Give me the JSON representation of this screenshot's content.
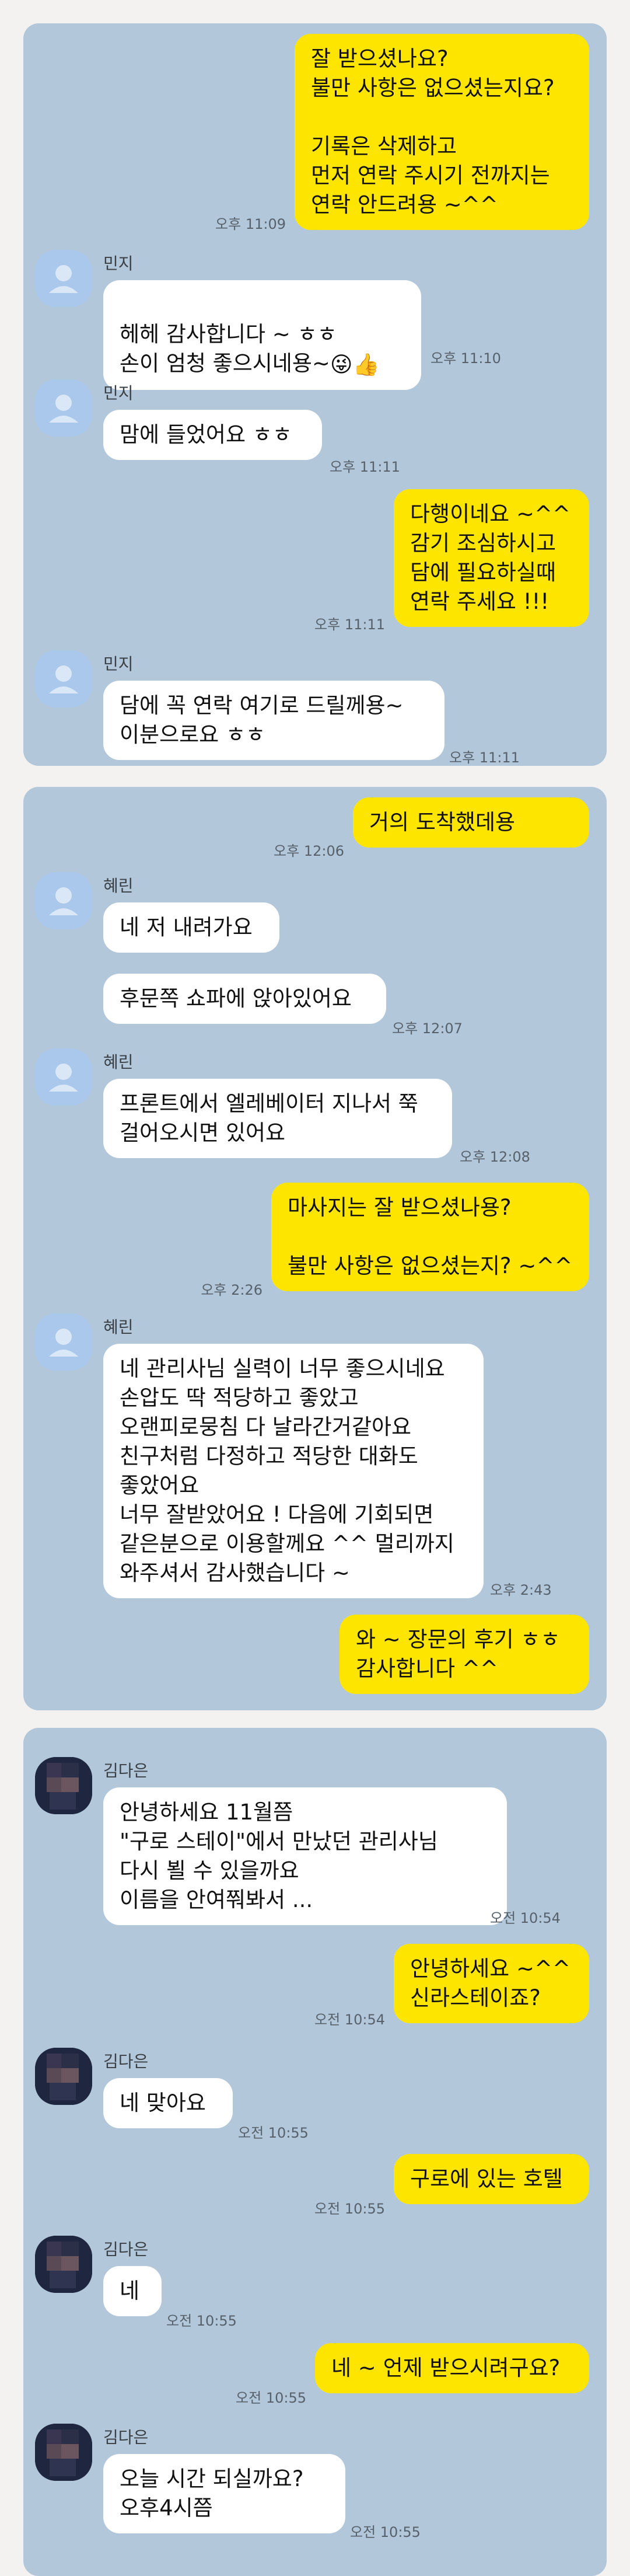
{
  "panels": [
    {
      "messages": [
        {
          "side": "me",
          "text": "잘 받으셨나요?\n불만 사항은 없으셨는지요?\n\n기록은 삭제하고\n먼저 연락 주시기 전까지는\n연락 안드려용 ~^^",
          "time": "오후 11:09"
        },
        {
          "side": "them",
          "sender": "민지",
          "text": "헤헤 감사합니다 ~ ㅎㅎ\n손이 엄청 좋으시네용~",
          "emoji": "😜👍",
          "time": "오후 11:10"
        },
        {
          "side": "them",
          "sender": "민지",
          "text": "맘에 들었어요 ㅎㅎ",
          "time": "오후 11:11"
        },
        {
          "side": "me",
          "text": "다행이네요 ~^^\n감기 조심하시고\n담에 필요하실때\n연락 주세요 !!!",
          "time": "오후 11:11"
        },
        {
          "side": "them",
          "sender": "민지",
          "text": "담에 꼭 연락 여기로 드릴께용~\n이분으로요 ㅎㅎ",
          "time": "오후 11:11"
        }
      ]
    },
    {
      "messages": [
        {
          "side": "me",
          "text": "거의 도착했데용",
          "time": "오후 12:06"
        },
        {
          "side": "them",
          "sender": "혜린",
          "text": "네 저 내려가요",
          "time": ""
        },
        {
          "side": "them",
          "text": "후문쪽 쇼파에 앉아있어요",
          "time": "오후 12:07"
        },
        {
          "side": "them",
          "sender": "혜린",
          "text": "프론트에서 엘레베이터 지나서 쭉\n걸어오시면 있어요",
          "time": "오후 12:08"
        },
        {
          "side": "me",
          "text": "마사지는 잘 받으셨나용?\n\n불만 사항은 없으셨는지? ~^^",
          "time": "오후 2:26"
        },
        {
          "side": "them",
          "sender": "혜린",
          "text": "네 관리사님 실력이 너무 좋으시네요\n손압도 딱 적당하고 좋았고\n오랜피로뭉침 다 날라간거같아요\n친구처럼 다정하고 적당한 대화도\n좋았어요\n너무 잘받았어요 ! 다음에 기회되면\n같은분으로 이용할께요 ^^ 멀리까지\n와주셔서 감사했습니다 ~",
          "time": "오후 2:43"
        },
        {
          "side": "me",
          "text": "와 ~ 장문의 후기 ㅎㅎ\n감사합니다 ^^",
          "time": ""
        }
      ]
    },
    {
      "messages": [
        {
          "side": "them",
          "sender": "김다은",
          "text": "안녕하세요 11월쯤\n\"구로 스테이\"에서 만났던 관리사님\n다시 뵐 수 있을까요\n이름을 안여쭤봐서 ...",
          "time": "오전 10:54"
        },
        {
          "side": "me",
          "text": "안녕하세요 ~^^\n신라스테이죠?",
          "time": "오전 10:54"
        },
        {
          "side": "them",
          "sender": "김다은",
          "text": "네 맞아요",
          "time": "오전 10:55"
        },
        {
          "side": "me",
          "text": "구로에 있는 호텔",
          "time": "오전 10:55"
        },
        {
          "side": "them",
          "sender": "김다은",
          "text": "네",
          "time": "오전 10:55"
        },
        {
          "side": "me",
          "text": "네 ~ 언제 받으시려구요?",
          "time": "오전 10:55"
        },
        {
          "side": "them",
          "sender": "김다은",
          "text": "오늘 시간 되실까요?\n오후4시쯤",
          "time": "오전 10:55"
        }
      ]
    }
  ],
  "colors": {
    "me_bubble": "#fee500",
    "them_bubble": "#ffffff",
    "chat_bg": "#b2c7da"
  },
  "icons": {
    "default_avatar": "person-icon",
    "photo_avatar": "pixelated-photo"
  }
}
